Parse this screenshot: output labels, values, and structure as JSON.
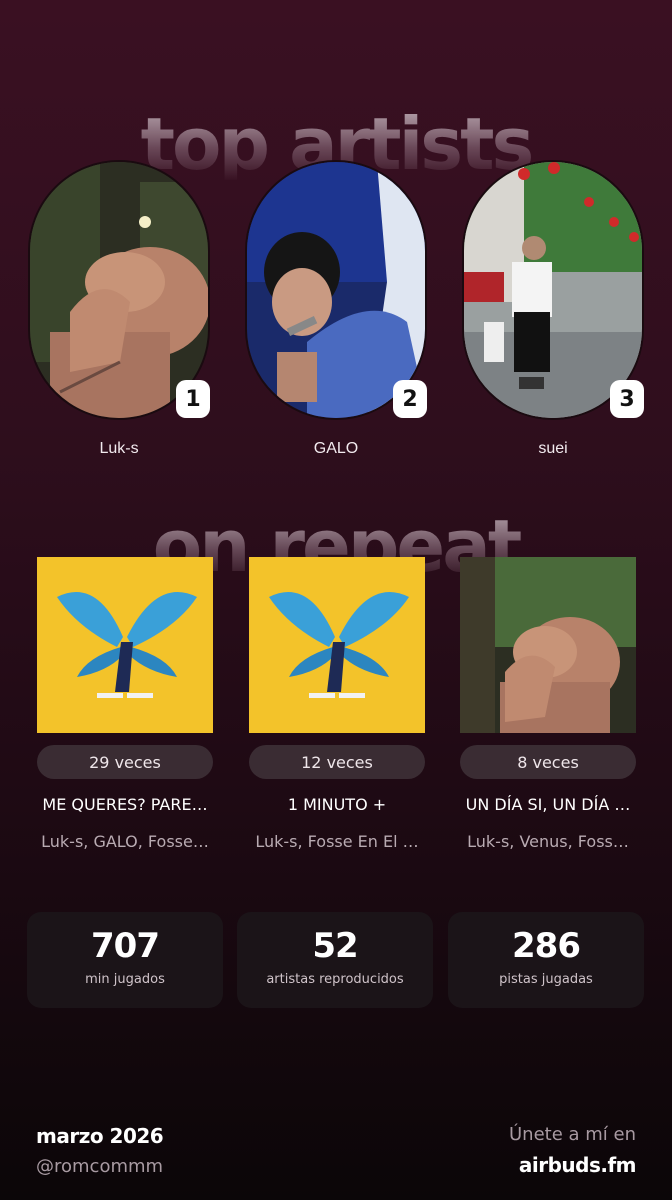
{
  "sections": {
    "top_artists_title": "top artists",
    "on_repeat_title": "on repeat"
  },
  "artists": [
    {
      "rank": "1",
      "name": "Luk-s"
    },
    {
      "rank": "2",
      "name": "GALO"
    },
    {
      "rank": "3",
      "name": "suei"
    }
  ],
  "tracks": [
    {
      "plays": "29 veces",
      "title": "ME QUERES? PARE…",
      "artists": "Luk-s, GALO, Fosse…"
    },
    {
      "plays": "12 veces",
      "title": "1 MINUTO +",
      "artists": "Luk-s, Fosse En El …"
    },
    {
      "plays": "8 veces",
      "title": "UN DÍA SI, UN DÍA …",
      "artists": "Luk-s, Venus, Foss…"
    }
  ],
  "stats": [
    {
      "value": "707",
      "label": "min jugados"
    },
    {
      "value": "52",
      "label": "artistas reproducidos"
    },
    {
      "value": "286",
      "label": "pistas jugadas"
    }
  ],
  "footer": {
    "date": "marzo 2026",
    "handle": "@romcommm",
    "join": "Únete a mí en",
    "site": "airbuds.fm"
  },
  "colors": {
    "background_top": "#3a1022",
    "background_bottom": "#0b0608",
    "album_yellow": "#f3c32a",
    "butterfly_blue": "#3aa0d8",
    "pill": "#3a2c33",
    "stat_card": "#1b1418"
  }
}
